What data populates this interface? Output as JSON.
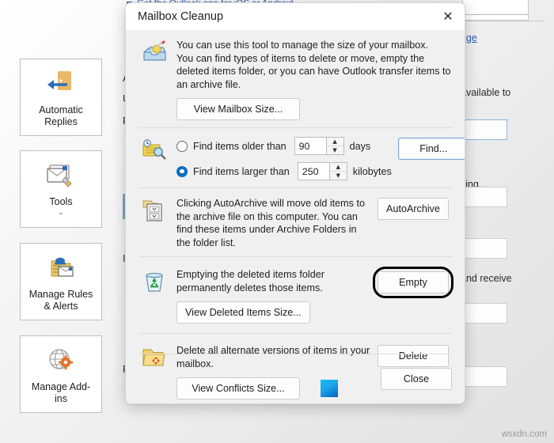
{
  "background": {
    "top_banner_text": "Get the Outlook app for iOS or Android.",
    "link_fragment": "ange",
    "text_fragments": [
      "available to",
      "ving.",
      "and receive"
    ],
    "left_text_fragments": [
      "A",
      "U",
      "P",
      "I",
      "P"
    ]
  },
  "command_column": {
    "buttons": [
      {
        "label": "Automatic\nReplies",
        "icon": "automatic-replies-icon",
        "has_caret": false
      },
      {
        "label": "Tools",
        "icon": "tools-icon",
        "has_caret": true,
        "caret": "⌄"
      },
      {
        "label": "Manage Rules\n& Alerts",
        "icon": "manage-rules-icon",
        "has_caret": false
      },
      {
        "label": "Manage Add-\nins",
        "icon": "manage-addins-icon",
        "has_caret": false
      }
    ]
  },
  "dialog": {
    "title": "Mailbox Cleanup",
    "close_icon": "✕",
    "sections": {
      "overview": {
        "icon": "mailbox-cleanup-icon",
        "line1": "You can use this tool to manage the size of your mailbox.",
        "line2": "You can find types of items to delete or move, empty the deleted items folder, or you can have Outlook transfer items to an archive file.",
        "button": "View Mailbox Size..."
      },
      "find": {
        "icon": "find-items-icon",
        "radio_older_label": "Find items older than",
        "radio_older_checked": false,
        "radio_larger_label": "Find items larger than",
        "radio_larger_checked": true,
        "days_value": "90",
        "days_unit": "days",
        "kilobytes_value": "250",
        "kilobytes_unit": "kilobytes",
        "button": "Find..."
      },
      "autoarchive": {
        "icon": "autoarchive-icon",
        "text": "Clicking AutoArchive will move old items to the archive file on this computer. You can find these items under Archive Folders in the folder list.",
        "button": "AutoArchive"
      },
      "deleted": {
        "icon": "recycle-bin-icon",
        "text": "Emptying the deleted items folder permanently deletes those items.",
        "button_view": "View Deleted Items Size...",
        "button_empty": "Empty",
        "empty_highlighted": true
      },
      "conflicts": {
        "icon": "conflicts-folder-icon",
        "text": "Delete all alternate versions of items in your mailbox.",
        "button_view": "View Conflicts Size...",
        "button_delete": "Delete",
        "tile_icon": "blue-gradient-tile"
      }
    },
    "footer": {
      "close_button": "Close"
    }
  },
  "watermark": "wsxdn.com",
  "colors": {
    "accent_blue": "#0a6ebd",
    "link_blue": "#2a5db0",
    "dialog_bg": "#f0f0f0",
    "titlebar_bg": "#ffffff",
    "highlight_ring": "#000000"
  }
}
